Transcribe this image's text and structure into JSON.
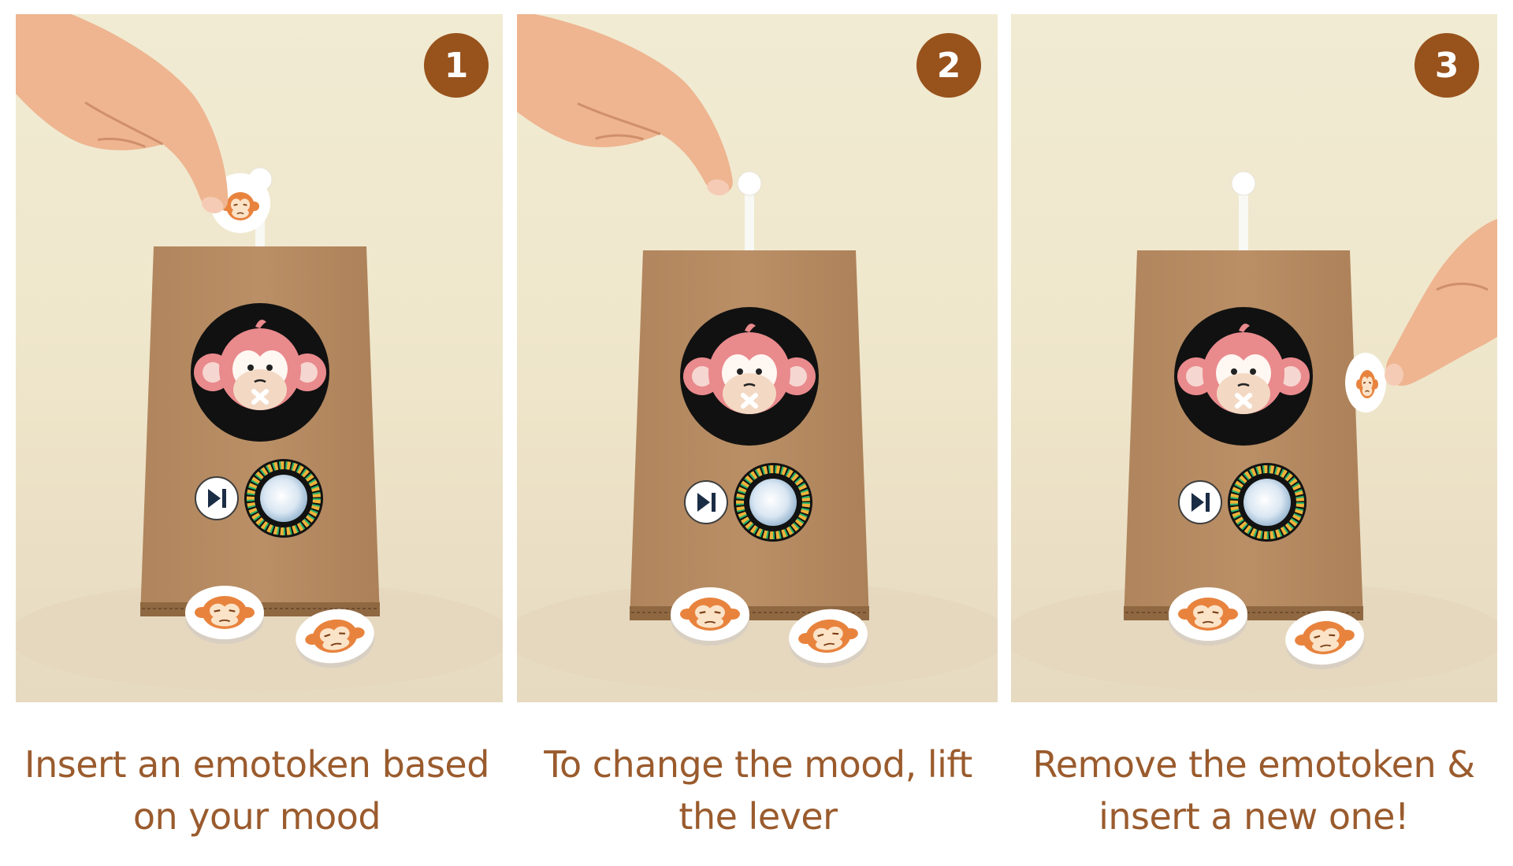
{
  "colors": {
    "badge": "#98521c",
    "caption_text": "#9a5b2d",
    "cardboard": "#b58a62",
    "background": "#efe7cc"
  },
  "icons": [
    "monkey-face-icon",
    "play-pause-icon",
    "volume-dial-icon",
    "emotoken-icon",
    "lever-icon",
    "hand-icon"
  ],
  "steps": [
    {
      "number": "1",
      "caption_line1": "Insert an emotoken based",
      "caption_line2": "on your mood"
    },
    {
      "number": "2",
      "caption_line1": "To change the mood, lift",
      "caption_line2": "the lever"
    },
    {
      "number": "3",
      "caption_line1": "Remove the emotoken &",
      "caption_line2": "insert a new one!"
    }
  ]
}
